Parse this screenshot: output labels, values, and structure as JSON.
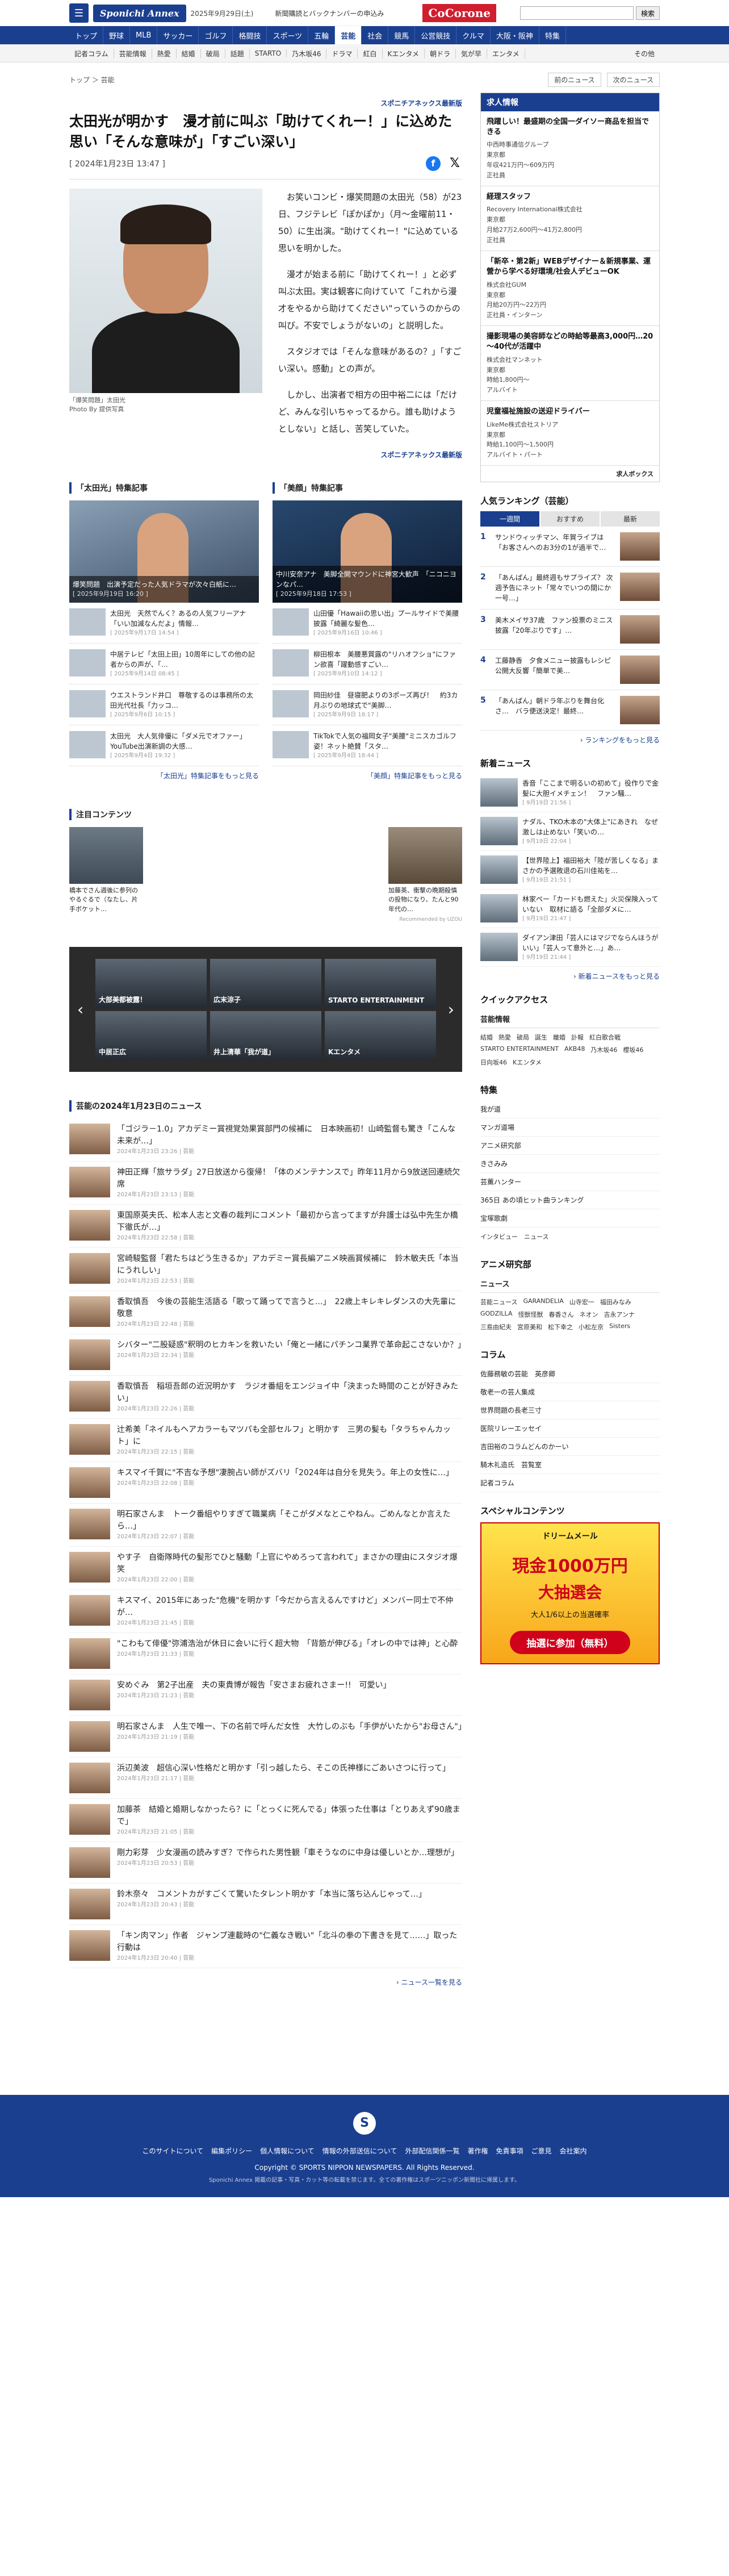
{
  "header": {
    "menu_icon": "menu-icon",
    "logo": "Sponichi Annex",
    "date": "2025年9月29日(土)",
    "link": "新聞購読とバックナンバーの申込み",
    "cocorone": "CoCorone",
    "search_btn": "検索",
    "search_placeholder": ""
  },
  "nav": [
    "トップ",
    "野球",
    "MLB",
    "サッカー",
    "ゴルフ",
    "格闘技",
    "スポーツ",
    "五輪",
    "芸能",
    "社会",
    "競馬",
    "公営競技",
    "クルマ",
    "大阪・阪神",
    "特集"
  ],
  "subnav": [
    "記者コラム",
    "芸能情報",
    "熱愛",
    "結婚",
    "破局",
    "話題",
    "STARTO",
    "乃木坂46",
    "ドラマ",
    "紅白",
    "Kエンタメ",
    "朝ドラ",
    "気が早",
    "エンタメ"
  ],
  "subnav_more": "その他",
  "breadcrumb": "トップ ＞ 芸能",
  "pager": {
    "prev": "前のニュース",
    "next": "次のニュース"
  },
  "article": {
    "source": "スポニチアネックス最新版",
    "title": "太田光が明かす　漫才前に叫ぶ「助けてくれー！」に込めた思い「そんな意味が」「すごい深い」",
    "date": "[ 2024年1月23日 13:47 ]",
    "photo_caption": "「爆笑問題」太田光",
    "photo_credit": "Photo By 提供写真",
    "p1": "お笑いコンビ・爆笑問題の太田光（58）が23日、フジテレビ「ぽかぽか」（月～金曜前11・50）に生出演。\"助けてくれー！\"に込めている思いを明かした。",
    "p2": "漫才が始まる前に「助けてくれー！」と必ず叫ぶ太田。実は観客に向けていて「これから漫才をやるから助けてください\"っていうのからの叫び。不安でしょうがないの」と説明した。",
    "p3": "スタジオでは「そんな意味があるの？」「すごい深い。感動」との声が。",
    "p4": "しかし、出演者で相方の田中裕二には「だけど、みんな引いちゃってるから。誰も助けようとしない」と話し、苦笑していた。",
    "end": "スポニチアネックス最新版"
  },
  "features": [
    {
      "title": "「太田光」特集記事",
      "big": {
        "text": "爆笑問題　出演予定だった人気ドラマが次々白紙に…",
        "date": "[ 2025年9月19日 16:20 ]"
      },
      "items": [
        {
          "t": "太田光　天然でんく？あるの人気フリーアナ「いい加減なんだよ」情報…",
          "d": "[ 2025年9月17日 14:54 ]"
        },
        {
          "t": "中居テレビ「太田上田」10周年にしての他の記者からの声が、「…",
          "d": "[ 2025年9月14日 08:45 ]"
        },
        {
          "t": "ウエストランド井口　尊敬するのは事務所の太田光代社長「力ッコ…",
          "d": "[ 2025年9月6日 10:15 ]"
        },
        {
          "t": "太田光　大人気俳優に「ダメ元でオファー」YouTube出演新調の大感…",
          "d": "[ 2025年9月4日 19:32 ]"
        }
      ],
      "more": "「太田光」特集記事をもっと見る"
    },
    {
      "title": "「美顔」特集記事",
      "big": {
        "text": "中川安奈アナ　美脚全開マウンドに神宮大歓声　「ニコニヨンなパ…",
        "date": "[ 2025年9月18日 17:53 ]"
      },
      "items": [
        {
          "t": "山田優「Hawaiiの思い出」プールサイドで美腰披露「綺麗な髪色…",
          "d": "[ 2025年9月16日 10:46 ]"
        },
        {
          "t": "柳田根本　美腰悪質露の\"リハオフショ\"にファン欲喜「躍動感すごい…",
          "d": "[ 2025年9月10日 14:12 ]"
        },
        {
          "t": "岡田紗佳　昼寝肥よりの3ポーズ再び！　約3カ月ぶりの地球式で\"美脚…",
          "d": "[ 2025年9月9日 18:17 ]"
        },
        {
          "t": "TikTokで人気の福岡女子\"美腰\"ミニスカゴルフ姿！ネット絶賛「スタ…",
          "d": "[ 2025年9月4日 18:44 ]"
        }
      ],
      "more": "「美顔」特集記事をもっと見る"
    }
  ],
  "reco": {
    "title": "注目コンテンツ",
    "items": [
      {
        "t": "橋本でさん週後に参列のやるぐるで（なたし、片手ボケット…"
      },
      {
        "t": "加藤英、衝撃の晩期殺慎の投物になり、たんと90年代の…"
      }
    ],
    "by": "Recommended by UZOU"
  },
  "carousel": {
    "cells": [
      "大部美都被露！",
      "広末涼子",
      "STARTO ENTERTAINMENT",
      "中居正広",
      "井上清華「我が道」",
      "Kエンタメ"
    ]
  },
  "newslist": {
    "title": "芸能の2024年1月23日のニュース",
    "items": [
      {
        "t": "「ゴジラ－1.0」アカデミー賞視覚効果賞部門の候補に　日本映画初！山崎監督も驚き「こんな未来が…」",
        "d": "2024年1月23日 23:26 | 芸能"
      },
      {
        "t": "神田正輝「旅サラダ」27日放送から復帰！「体のメンテナンスで」昨年11月から9放送回連続欠席",
        "d": "2024年1月23日 23:13 | 芸能"
      },
      {
        "t": "東国原英夫氏、松本人志と文春の裁判にコメント「最初から言ってますが弁護士は弘中先生か橋下徹氏が…」",
        "d": "2024年1月23日 22:58 | 芸能"
      },
      {
        "t": "宮崎駿監督「君たちはどう生きるか」アカデミー賞長編アニメ映画賞候補に　鈴木敏夫氏「本当にうれしい」",
        "d": "2024年1月23日 22:53 | 芸能"
      },
      {
        "t": "香取慎吾　今後の芸能生活語る「歌って踊ってで言うと…」　22歳上キレキレダンスの大先輩に敬意",
        "d": "2024年1月23日 22:48 | 芸能"
      },
      {
        "t": "シバター\"二股疑惑\"釈明のヒカキンを救いたい「俺と一緒にパチンコ業界で革命起こさないか？」",
        "d": "2024年1月23日 22:34 | 芸能"
      },
      {
        "t": "香取慎吾　稲垣吾郎の近況明かす　ラジオ番組をエンジョイ中「決まった時間のことが好きみたい」",
        "d": "2024年1月23日 22:26 | 芸能"
      },
      {
        "t": "辻希美「ネイルもヘアカラーもマツパも全部セルフ」と明かす　三男の髪も「タラちゃんカット」に",
        "d": "2024年1月23日 22:15 | 芸能"
      },
      {
        "t": "キスマイ千賀に\"不吉な予想\"凄腕占い師がズバリ「2024年は自分を見失う。年上の女性に…」",
        "d": "2024年1月23日 22:08 | 芸能"
      },
      {
        "t": "明石家さんま　トーク番組やりすぎて職業病「そこがダメなとこやねん。ごめんなとか言えたら…」",
        "d": "2024年1月23日 22:07 | 芸能"
      },
      {
        "t": "やす子　自衛隊時代の髪形でひと騒動「上官にやめろって言われて」まさかの理由にスタジオ爆笑",
        "d": "2024年1月23日 22:00 | 芸能"
      },
      {
        "t": "キスマイ、2015年にあった\"危機\"を明かす「今だから言えるんですけど」メンバー同士で不仲が…",
        "d": "2024年1月23日 21:45 | 芸能"
      },
      {
        "t": "\"こわもて俳優\"弥浦浩治が休日に会いに行く超大物　「背筋が伸びる」「オレの中では神」と心酔",
        "d": "2024年1月23日 21:33 | 芸能"
      },
      {
        "t": "安めぐみ　第2子出産　夫の東貴博が報告「安さまお疲れさまー!!　可愛い」",
        "d": "2024年1月23日 21:23 | 芸能"
      },
      {
        "t": "明石家さんま　人生で唯一、下の名前で呼んだ女性　大竹しのぶも「手伊がいたから\"お母さん\"」",
        "d": "2024年1月23日 21:19 | 芸能"
      },
      {
        "t": "浜辺美波　超信心深い性格だと明かす「引っ越したら、そこの氏神様にごあいさつに行って」",
        "d": "2024年1月23日 21:17 | 芸能"
      },
      {
        "t": "加藤茶　結婚と婚期しなかったら？に「とっくに死んでる」体張った仕事は「とりあえず90歳まで」",
        "d": "2024年1月23日 21:05 | 芸能"
      },
      {
        "t": "剛力彩芽　少女漫画の読みすぎ？で作られた男性観「車そうなのに中身は優しいとか…理想が」",
        "d": "2024年1月23日 20:53 | 芸能"
      },
      {
        "t": "鈴木奈々　コメントカがすごくて驚いたタレント明かす「本当に落ち込んじゃって…」",
        "d": "2024年1月23日 20:43 | 芸能"
      },
      {
        "t": "「キン肉マン」作者　ジャンプ連載時の\"仁義なき戦い\"「北斗の拳の下書きを見て……」取った行動は",
        "d": "2024年1月23日 20:40 | 芸能"
      }
    ],
    "more": "ニュース一覧を見る"
  },
  "jobs": {
    "title": "求人情報",
    "items": [
      {
        "t": "飛躍しい！最盛期の全国一ダイソー商品を担当できる",
        "c": "中西時事通信グループ",
        "m": "東京都\n年収421万円～609万円\n正社員"
      },
      {
        "t": "経理スタッフ",
        "c": "Recovery International株式会社",
        "m": "東京都\n月給27万2,600円～41万2,800円\n正社員"
      },
      {
        "t": "「新卒・第2新」WEBデザイナー＆新規事業、運營から学べる好環境/社会人デビューOK",
        "c": "株式会社GUM",
        "m": "東京都\n月給20万円～22万円\n正社員・インターン"
      },
      {
        "t": "撮影現場の美容師などの時給等最高3,000円…20～40代が活躍中",
        "c": "株式会社マンネット",
        "m": "東京都\n時給1,800円～\nアルバイト"
      },
      {
        "t": "児童福祉施設の送迎ドライバー",
        "c": "LikeMe株式会社ストリア",
        "m": "東京都\n時給1,100円～1,500円\nアルバイト・パート"
      }
    ],
    "footer": "求人ボックス"
  },
  "ranking": {
    "title": "人気ランキング（芸能）",
    "tabs": [
      "一週間",
      "おすすめ",
      "最新"
    ],
    "items": [
      {
        "n": "1",
        "t": "サンドウィッチマン、年賀ライブは「お客さんへのお3分の1が過半で…"
      },
      {
        "n": "2",
        "t": "「あんぱん」最終週もサプライズ？ 次週予告にネット「常々でいつの間にか一号…」"
      },
      {
        "n": "3",
        "t": "美木メイサ37歳　ファン投票のミニス披露「20年ぶりです」…"
      },
      {
        "n": "4",
        "t": "工藤静香　夕食メニュー披露もレシピ公開大反響「簡単で美…"
      },
      {
        "n": "5",
        "t": "「あんぱん」朝ドラ年ぶりを舞台化さ…　バラ便送決定！最終…"
      }
    ],
    "more": "ランキングをもっと見る"
  },
  "snews": {
    "title": "新着ニュース",
    "items": [
      {
        "t": "香音「ここまで明るいの初めて」役作りで金髪に大胆イメチェン！　ファン騒…",
        "d": "[ 9月19日 21:56 ]"
      },
      {
        "t": "ナダル、TKO木本の\"大体上\"にあきれ　なぜ激しは止めない「笑いの…",
        "d": "[ 9月19日 22:04 ]"
      },
      {
        "t": "【世界陸上】福田裕大「陸が苦しくなる」まさかの予選敗退の石川佳祐を…",
        "d": "[ 9月19日 21:51 ]"
      },
      {
        "t": "林家ペー「カードも燃えた」火災保険入っていない　取材に語る「全部ダメに…",
        "d": "[ 9月19日 21:47 ]"
      },
      {
        "t": "ダイアン津田「芸人にはマジでならんほうがいい」「芸人って意外と…」あ…",
        "d": "[ 9月19日 21:44 ]"
      }
    ],
    "more": "新着ニュースをもっと見る"
  },
  "quick": {
    "title": "クイックアクセス",
    "head": "芸能情報",
    "tags": [
      "結婚",
      "熱愛",
      "破局",
      "誕生",
      "離婚",
      "訃報",
      "紅白歌合戦",
      "STARTO ENTERTAINMENT",
      "AKB48",
      "乃木坂46",
      "櫻坂46",
      "日向坂46",
      "Kエンタメ"
    ]
  },
  "special": {
    "title": "特集",
    "rows": [
      "我が道",
      "マンガ道場",
      "アニメ研究部",
      "きさみみ",
      "芸薫ハンター",
      "365日 あの頃ヒット曲ランキング",
      "宝塚歌劇"
    ],
    "tags": "インタビュー　ニュース"
  },
  "anime": {
    "title": "アニメ研究部",
    "head": "ニュース",
    "tags": [
      "芸能ニュース",
      "GARANDELIA",
      "山寺宏一",
      "福田みなみ",
      "GODZILLA",
      "怪獣怪獣",
      "春香さん",
      "ネオン",
      "吉永アンナ",
      "三島由紀夫",
      "宮原美和",
      "松下幸之",
      "小松左京",
      "Sisters"
    ]
  },
  "column": {
    "title": "コラム",
    "rows": [
      "佐藤務敏の芸能　英彦卿",
      "敬老一の芸人集成",
      "世界問題の長老三寸",
      "医院リレーエッセイ",
      "吉田裕のコラムどんのかーい",
      "騎木礼造氏　芸覧室",
      "記者コラム"
    ]
  },
  "specialcontent": {
    "title": "スペシャルコンテンツ"
  },
  "banner": {
    "t1": "ドリームメール",
    "t2": "現金1000万円",
    "t3": "大抽選会",
    "t4": "大人1/6以上の当選確率",
    "btn": "抽選に参加（無料）"
  },
  "footer": {
    "links": [
      "このサイトについて",
      "編集ポリシー",
      "個人情報について",
      "情報の外部送信について",
      "外部配信関係一覧",
      "著作権",
      "免責事項",
      "ご意見",
      "会社案内"
    ],
    "copy": "Copyright © SPORTS NIPPON NEWSPAPERS. All Rights Reserved.",
    "copy2": "Sponichi Annex 掲載の記事・写真・カット等の転載を禁じます。全ての著作権はスポーツニッポン新聞社に帰属します。"
  }
}
